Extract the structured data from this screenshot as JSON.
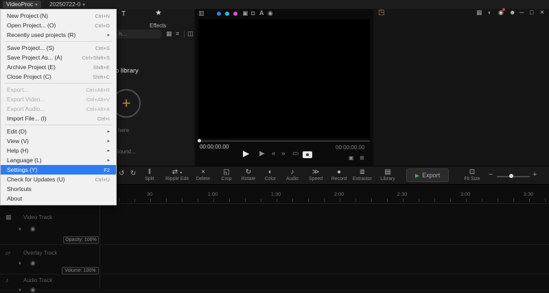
{
  "titlebar": {
    "app_menu_label": "VideoProc",
    "project_name": "20250722-0"
  },
  "file_menu": {
    "items": [
      {
        "label": "New Project (N)",
        "shortcut": "Ctrl+N"
      },
      {
        "label": "Open Project... (O)",
        "shortcut": "Ctrl+O"
      },
      {
        "label": "Recently used projects (R)",
        "submenu": true
      },
      {
        "label": "Save Project... (S)",
        "shortcut": "Ctrl+S"
      },
      {
        "label": "Save Project As... (A)",
        "shortcut": "Ctrl+Shift+S"
      },
      {
        "label": "Archive Project (E)",
        "shortcut": "Shift+E"
      },
      {
        "label": "Close Project (C)",
        "shortcut": "Shift+C"
      },
      {
        "label": "Export...",
        "shortcut": "Ctrl+Alt+R",
        "disabled": true
      },
      {
        "label": "Export Video...",
        "shortcut": "Ctrl+Alt+V",
        "disabled": true
      },
      {
        "label": "Export Audio...",
        "shortcut": "Ctrl+Alt+A",
        "disabled": true
      },
      {
        "label": "Import File... (I)",
        "shortcut": "Ctrl+I"
      },
      {
        "label": "Edit (D)",
        "submenu": true
      },
      {
        "label": "View (V)",
        "submenu": true
      },
      {
        "label": "Help (H)",
        "submenu": true
      },
      {
        "label": "Language (L)",
        "submenu": true
      },
      {
        "label": "Settings (Y)",
        "shortcut": "F2",
        "highlighted": true
      },
      {
        "label": "Check for Updates (U)",
        "shortcut": "Ctrl+U"
      },
      {
        "label": "Shortcuts"
      },
      {
        "label": "About"
      }
    ]
  },
  "media_panel": {
    "effects_tab_label": "Effects",
    "search_text": "h...",
    "library_label": "o library",
    "drop_hint": "here",
    "record_hint": "Sound..."
  },
  "player": {
    "timecode_left": "00:00:00.00",
    "timecode_right": "00:00:00.00"
  },
  "toolbar": {
    "items": [
      {
        "label": "Split"
      },
      {
        "label": "Ripple Edit"
      },
      {
        "label": "Delete"
      },
      {
        "label": "Crop"
      },
      {
        "label": "Rotate"
      },
      {
        "label": "Color"
      },
      {
        "label": "Audio"
      },
      {
        "label": "Speed"
      },
      {
        "label": "Record"
      },
      {
        "label": "Extractor"
      }
    ],
    "library_label": "Library",
    "export_label": "Export",
    "fit_size_label": "Fit Size"
  },
  "timeline": {
    "ruler_labels": [
      "30",
      "1:00",
      "1:30",
      "2:00",
      "2:30",
      "3:00",
      "3:30"
    ],
    "tracks": [
      {
        "name": "Video Track",
        "badge": "Opacity: 100%"
      },
      {
        "name": "Overlay Track",
        "badge": "Volume: 100%"
      },
      {
        "name": "Audio Track"
      }
    ]
  },
  "colors": {
    "accent_blue": "#2e7cf2",
    "dot_blue": "#2d7ff0",
    "dot_cyan": "#19c3e6",
    "dot_magenta": "#e14fd2",
    "notification_red": "#e03b3b",
    "export_green": "#3fae4e",
    "inspector_orange": "#cf9a3d",
    "plus_orange": "#c08a3e"
  },
  "icons": {
    "caret_down": "▾",
    "submenu_arrow": "▸",
    "histogram": "▥",
    "mask": "▣",
    "lock": "◘",
    "letter_a": "A",
    "eye": "◉",
    "camera": "▦",
    "speaker": "◖",
    "bell": "◉",
    "user": "☻",
    "minimize": "─",
    "maximize": "□",
    "close": "×",
    "inspector": "◳",
    "star": "★",
    "tab_t": "T",
    "grid": "▦",
    "sort": "≡",
    "panel": "◫",
    "plus": "+",
    "play": "▶",
    "play_alt": "▶",
    "step_back": "«",
    "step_fwd": "»",
    "clip": "▭",
    "shot_small": "▣",
    "fullscreen": "⊞",
    "undo": "↺",
    "redo": "↻",
    "split": "‖",
    "ripple": "⇄",
    "delete": "×",
    "crop": "◱",
    "rotate": "↻",
    "color": "◐",
    "audio": "♪",
    "speed": "≫",
    "record": "●",
    "extractor": "≣",
    "library": "▤",
    "export_play": "▶",
    "fit": "⊡",
    "minus": "−",
    "zoom_plus": "+",
    "video_track": "▦",
    "overlay_track": "▱",
    "audio_track": "♪",
    "speaker_track": "◖",
    "eye_track": "◉"
  }
}
